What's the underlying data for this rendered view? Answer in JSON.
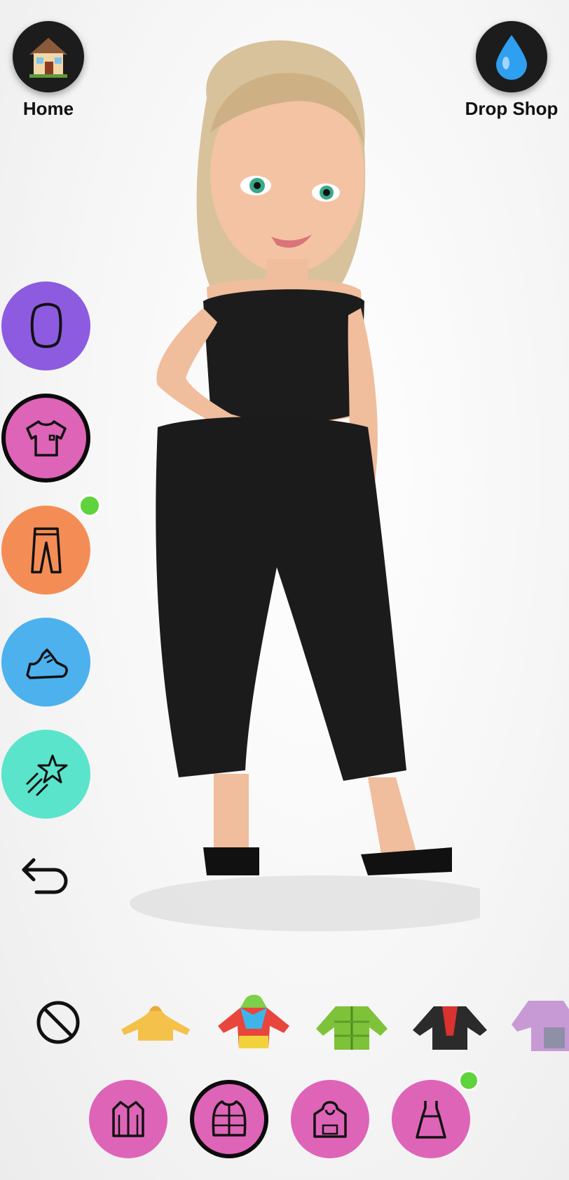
{
  "top_left": {
    "label": "Home",
    "icon": "house-icon"
  },
  "top_right": {
    "label": "Drop Shop",
    "icon": "droplet-icon"
  },
  "categories": [
    {
      "id": "face",
      "icon": "face-outline-icon",
      "color": "#8d5be0",
      "selected": false,
      "new": false
    },
    {
      "id": "tops",
      "icon": "tshirt-icon",
      "color": "#de64b8",
      "selected": true,
      "new": false
    },
    {
      "id": "bottoms",
      "icon": "pants-icon",
      "color": "#f48d55",
      "selected": false,
      "new": true
    },
    {
      "id": "shoes",
      "icon": "sneaker-icon",
      "color": "#4db1ee",
      "selected": false,
      "new": false
    },
    {
      "id": "poses",
      "icon": "shooting-star-icon",
      "color": "#5ae4cb",
      "selected": false,
      "new": false
    }
  ],
  "undo": {
    "icon": "undo-arrow-icon"
  },
  "items": [
    {
      "icon": "none-icon"
    },
    {
      "icon": "yellow-hoodie-icon",
      "color": "#f4c24a"
    },
    {
      "icon": "rainbow-hoodie-icon",
      "color": "#e8453c"
    },
    {
      "icon": "green-puffer-icon",
      "color": "#7ec23a"
    },
    {
      "icon": "black-red-jacket-icon",
      "color": "#2b2b2b"
    },
    {
      "icon": "pink-coat-icon",
      "color": "#c79ad6"
    }
  ],
  "subcategories": [
    {
      "id": "shirt",
      "icon": "button-shirt-icon",
      "selected": false,
      "new": false
    },
    {
      "id": "jacket",
      "icon": "puffer-jacket-icon",
      "selected": true,
      "new": false
    },
    {
      "id": "hoodie",
      "icon": "hoodie-icon",
      "selected": false,
      "new": false
    },
    {
      "id": "dress",
      "icon": "dress-icon",
      "selected": false,
      "new": true
    }
  ],
  "colors": {
    "accent_new": "#5fd33b",
    "sub_pink": "#de64b8"
  }
}
